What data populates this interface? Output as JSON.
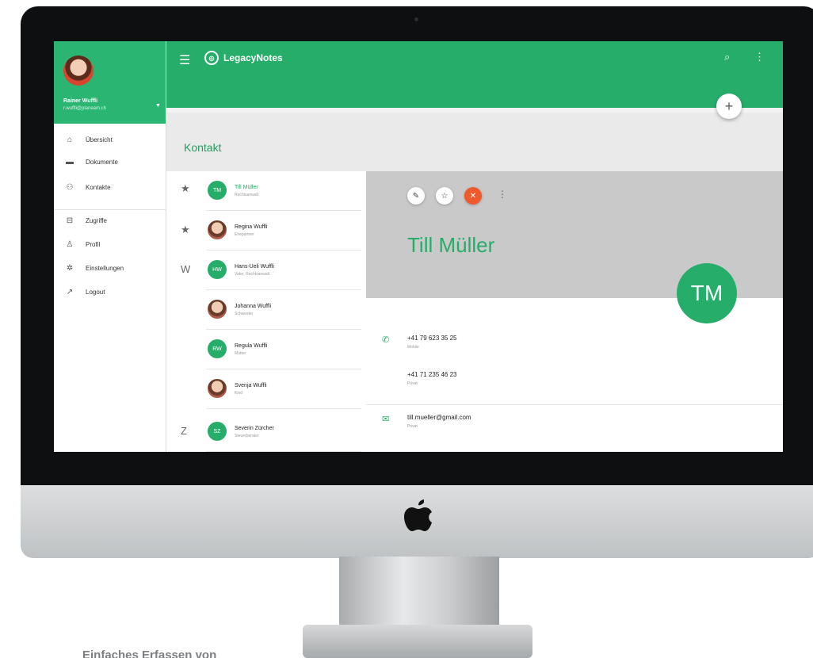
{
  "app": {
    "name": "LegacyNotes"
  },
  "user": {
    "name": "Rainer Wuffli",
    "email": "r.wuffli@planeam.ch"
  },
  "drawer": {
    "items": [
      {
        "label": "Übersicht",
        "icon": "home-icon"
      },
      {
        "label": "Dokumente",
        "icon": "folder-icon"
      },
      {
        "label": "Kontakte",
        "icon": "people-icon"
      },
      {
        "label": "Zugriffe",
        "icon": "lock-icon"
      },
      {
        "label": "Profil",
        "icon": "person-icon"
      },
      {
        "label": "Einstellungen",
        "icon": "gear-icon"
      },
      {
        "label": "Logout",
        "icon": "logout-arrow-icon"
      }
    ]
  },
  "section": {
    "title": "Kontakt"
  },
  "contacts": [
    {
      "group": "★",
      "initials": "TM",
      "name": "Till Müller",
      "sub": "Rechtsanwalt",
      "active": true
    },
    {
      "group": "★",
      "initials": "",
      "name": "Regina Wuffli",
      "sub": "Ehepartner",
      "active": false
    },
    {
      "group": "W",
      "initials": "HW",
      "name": "Hans-Ueli Wuffli",
      "sub": "Vater, Rechtsanwalt",
      "active": false
    },
    {
      "group": "",
      "initials": "",
      "name": "Johanna Wuffli",
      "sub": "Schwester",
      "active": false
    },
    {
      "group": "",
      "initials": "RW",
      "name": "Regula Wuffli",
      "sub": "Mutter",
      "active": false
    },
    {
      "group": "",
      "initials": "",
      "name": "Svenja Wuffli",
      "sub": "Kind",
      "active": false
    },
    {
      "group": "Z",
      "initials": "SZ",
      "name": "Severin Zürcher",
      "sub": "Steuerberater",
      "active": false
    }
  ],
  "detail": {
    "name": "Till Müller",
    "initials": "TM",
    "fields": [
      {
        "icon": "phone-icon",
        "value": "+41 79 623 35 25",
        "label": "Mobile"
      },
      {
        "icon": "",
        "value": "+41 71 235 46 23",
        "label": "Privat"
      },
      {
        "icon": "email-icon",
        "value": "till.mueller@gmail.com",
        "label": "Privat"
      }
    ]
  },
  "caption": "Einfaches Erfassen von",
  "colors": {
    "primary": "#27ad6a",
    "close": "#ee5a2c"
  }
}
